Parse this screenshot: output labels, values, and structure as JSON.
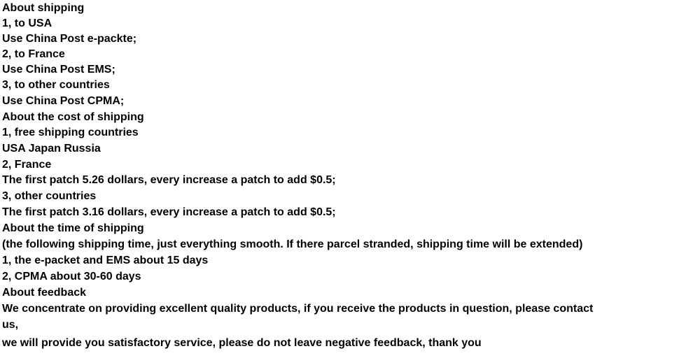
{
  "document": {
    "type": "shipping-policy",
    "background_color": "#ffffff",
    "text_color": "#000000",
    "sections": [
      {
        "id": "about-shipping",
        "heading": "About shipping",
        "lines": [
          "1, to USA",
          "Use China Post e-packte;",
          "2, to France",
          "Use China Post EMS;",
          "3, to other countries",
          "Use China Post CPMA;"
        ]
      },
      {
        "id": "about-cost",
        "heading": "About the cost of shipping",
        "lines": [
          "1, free shipping countries",
          "USA Japan Russia",
          "2, France",
          "The first patch 5.26 dollars, every increase a patch to add $0.5;",
          "3, other countries",
          "The first patch 3.16 dollars, every increase a patch to add $0.5;"
        ]
      },
      {
        "id": "about-time",
        "heading": "About the time of shipping",
        "lines": [
          "(the following shipping time, just everything smooth. If there parcel stranded, shipping time will be extended)",
          "1, the e-packet and EMS about 15 days",
          "2, CPMA about 30-60 days"
        ]
      },
      {
        "id": "about-feedback",
        "heading": "About feedback",
        "lines": [
          "We concentrate on providing excellent quality products, if you receive the products in question, please contact",
          "us,",
          "we will provide you satisfactory service, please do not leave negative feedback, thank you"
        ]
      }
    ],
    "all_lines": [
      "About shipping",
      "1, to USA",
      "Use China Post e-packte;",
      "2, to France",
      "Use China Post EMS;",
      "3, to other countries",
      "Use China Post CPMA;",
      "About the cost of shipping",
      "1, free shipping countries",
      "USA Japan Russia",
      "2, France",
      "The first patch 5.26 dollars, every increase a patch to add $0.5;",
      "3, other countries",
      "The first patch 3.16 dollars, every increase a patch to add $0.5;",
      "About the time of shipping",
      "(the following shipping time, just everything smooth. If there parcel stranded, shipping time will be extended)",
      "1, the e-packet and EMS about 15 days",
      "2, CPMA about 30-60 days",
      "About feedback",
      "We concentrate on providing excellent quality products, if you receive the products in question, please contact",
      "us,",
      "we will provide you satisfactory service, please do not leave negative feedback, thank you"
    ]
  }
}
